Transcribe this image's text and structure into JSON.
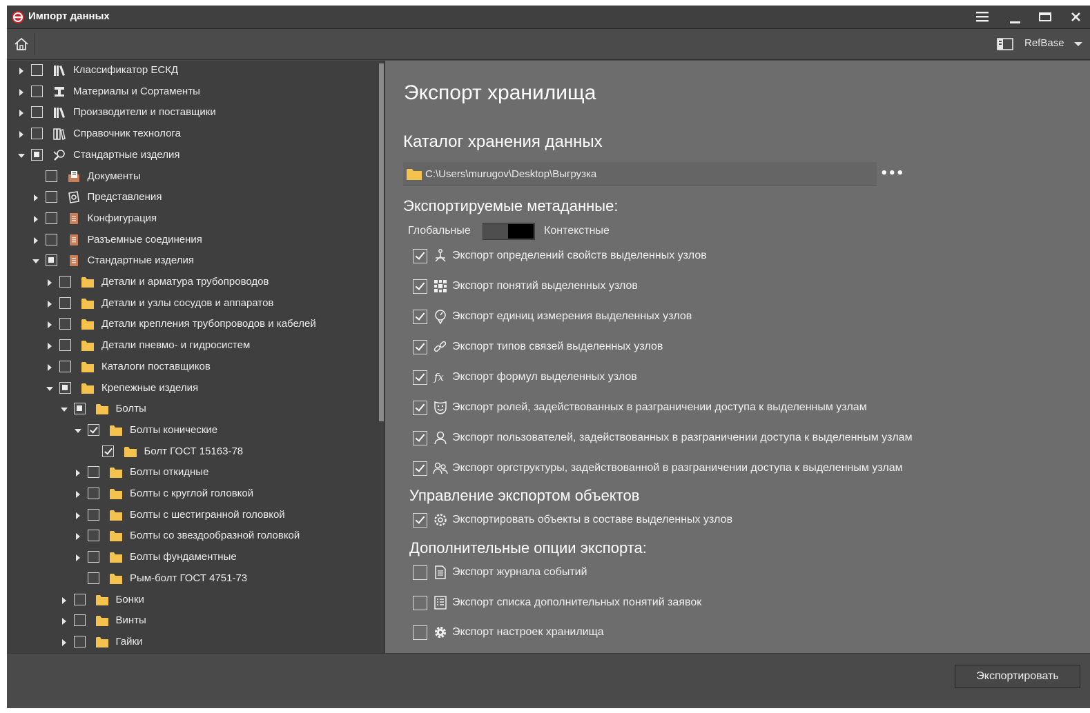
{
  "window": {
    "title": "Импорт данных",
    "menu_icon": "hamburger-icon",
    "minimize_icon": "minimize-icon",
    "maximize_icon": "maximize-icon",
    "close_icon": "close-icon"
  },
  "toolbar": {
    "home_icon": "home-icon",
    "panel_icon": "panel-toggle-icon",
    "database": "RefBase"
  },
  "tree": {
    "items": [
      {
        "label": "Классификатор ЕСКД",
        "level": 0,
        "state": "collapsed",
        "check": "unchecked",
        "icon": "library-icon"
      },
      {
        "label": "Материалы и Сортаменты",
        "level": 0,
        "state": "collapsed",
        "check": "unchecked",
        "icon": "materials-icon"
      },
      {
        "label": "Производители и поставщики",
        "level": 0,
        "state": "collapsed",
        "check": "unchecked",
        "icon": "library-icon"
      },
      {
        "label": "Справочник технолога",
        "level": 0,
        "state": "collapsed",
        "check": "unchecked",
        "icon": "books-icon"
      },
      {
        "label": "Стандартные изделия",
        "level": 0,
        "state": "expanded",
        "check": "partial",
        "icon": "tools-icon"
      },
      {
        "label": "Документы",
        "level": 1,
        "state": "leaf",
        "check": "unchecked",
        "icon": "document-folder-icon"
      },
      {
        "label": "Представления",
        "level": 1,
        "state": "collapsed",
        "check": "unchecked",
        "icon": "view-icon"
      },
      {
        "label": "Конфигурация",
        "level": 1,
        "state": "collapsed",
        "check": "unchecked",
        "icon": "catalog-book-icon"
      },
      {
        "label": "Разъемные соединения",
        "level": 1,
        "state": "collapsed",
        "check": "unchecked",
        "icon": "catalog-book-icon"
      },
      {
        "label": "Стандартные изделия",
        "level": 1,
        "state": "expanded",
        "check": "partial",
        "icon": "catalog-book-icon"
      },
      {
        "label": "Детали и арматура трубопроводов",
        "level": 2,
        "state": "collapsed",
        "check": "unchecked",
        "icon": "folder-icon"
      },
      {
        "label": "Детали и узлы сосудов и аппаратов",
        "level": 2,
        "state": "collapsed",
        "check": "unchecked",
        "icon": "folder-icon"
      },
      {
        "label": "Детали крепления трубопроводов и кабелей",
        "level": 2,
        "state": "collapsed",
        "check": "unchecked",
        "icon": "folder-icon"
      },
      {
        "label": "Детали пневмо- и гидросистем",
        "level": 2,
        "state": "collapsed",
        "check": "unchecked",
        "icon": "folder-icon"
      },
      {
        "label": "Каталоги поставщиков",
        "level": 2,
        "state": "collapsed",
        "check": "unchecked",
        "icon": "folder-icon"
      },
      {
        "label": "Крепежные изделия",
        "level": 2,
        "state": "expanded",
        "check": "partial",
        "icon": "folder-icon"
      },
      {
        "label": "Болты",
        "level": 3,
        "state": "expanded",
        "check": "partial",
        "icon": "folder-icon"
      },
      {
        "label": "Болты конические",
        "level": 4,
        "state": "expanded",
        "check": "checked",
        "icon": "folder-icon"
      },
      {
        "label": "Болт ГОСТ 15163-78",
        "level": 5,
        "state": "leaf",
        "check": "checked",
        "icon": "folder-icon"
      },
      {
        "label": "Болты откидные",
        "level": 4,
        "state": "collapsed",
        "check": "unchecked",
        "icon": "folder-icon"
      },
      {
        "label": "Болты с круглой головкой",
        "level": 4,
        "state": "collapsed",
        "check": "unchecked",
        "icon": "folder-icon"
      },
      {
        "label": "Болты с шестигранной головкой",
        "level": 4,
        "state": "collapsed",
        "check": "unchecked",
        "icon": "folder-icon"
      },
      {
        "label": "Болты со звездообразной головкой",
        "level": 4,
        "state": "collapsed",
        "check": "unchecked",
        "icon": "folder-icon"
      },
      {
        "label": "Болты фундаментные",
        "level": 4,
        "state": "collapsed",
        "check": "unchecked",
        "icon": "folder-icon"
      },
      {
        "label": "Рым-болт ГОСТ 4751-73",
        "level": 4,
        "state": "leaf",
        "check": "unchecked",
        "icon": "folder-icon"
      },
      {
        "label": "Бонки",
        "level": 3,
        "state": "collapsed",
        "check": "unchecked",
        "icon": "folder-icon"
      },
      {
        "label": "Винты",
        "level": 3,
        "state": "collapsed",
        "check": "unchecked",
        "icon": "folder-icon"
      },
      {
        "label": "Гайки",
        "level": 3,
        "state": "collapsed",
        "check": "unchecked",
        "icon": "folder-icon"
      }
    ]
  },
  "main": {
    "title": "Экспорт хранилища",
    "catalog": {
      "header": "Каталог хранения данных",
      "path": "C:\\Users\\murugov\\Desktop\\Выгрузка",
      "browse_label": "•••"
    },
    "metadata": {
      "header": "Экспортируемые метаданные:",
      "switch_left": "Глобальные",
      "switch_right": "Контекстные",
      "options": [
        {
          "label": "Экспорт определений свойств выделенных узлов",
          "checked": true,
          "icon": "properties-icon"
        },
        {
          "label": "Экспорт понятий выделенных узлов",
          "checked": true,
          "icon": "concepts-icon"
        },
        {
          "label": "Экспорт единиц измерения выделенных узлов",
          "checked": true,
          "icon": "units-icon"
        },
        {
          "label": "Экспорт типов связей выделенных узлов",
          "checked": true,
          "icon": "link-icon"
        },
        {
          "label": "Экспорт формул выделенных узлов",
          "checked": true,
          "icon": "formula-icon"
        },
        {
          "label": "Экспорт ролей, задействованных в разграничении доступа к выделенным узлам",
          "checked": true,
          "icon": "roles-mask-icon"
        },
        {
          "label": "Экспорт пользователей, задействованных в разграничении доступа к выделенным узлам",
          "checked": true,
          "icon": "user-icon"
        },
        {
          "label": "Экспорт оргструктуры, задействованной в разграничении доступа к выделенным узлам",
          "checked": true,
          "icon": "users-group-icon"
        }
      ]
    },
    "objects": {
      "header": "Управление экспортом объектов",
      "options": [
        {
          "label": "Экспортировать объекты в составе выделенных узлов",
          "checked": true,
          "icon": "object-gear-icon"
        }
      ]
    },
    "extra": {
      "header": "Дополнительные опции экспорта:",
      "options": [
        {
          "label": "Экспорт журнала событий",
          "checked": false,
          "icon": "journal-icon"
        },
        {
          "label": "Экспорт списка дополнительных понятий заявок",
          "checked": false,
          "icon": "list-icon"
        },
        {
          "label": "Экспорт настроек хранилища",
          "checked": false,
          "icon": "settings-gear-icon"
        }
      ]
    }
  },
  "footer": {
    "export_button": "Экспортировать"
  },
  "colors": {
    "folder": "#f5c34d",
    "book": "#c9805a",
    "logo": "#d0202a"
  }
}
